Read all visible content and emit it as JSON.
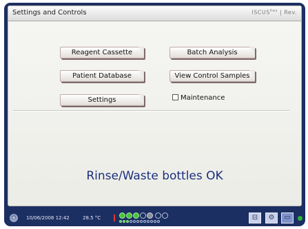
{
  "window": {
    "title": "Settings and Controls",
    "brand": "ISCUS",
    "brand_sup": "flex",
    "brand_suffix": " | Rev."
  },
  "buttons": {
    "reagent_cassette": "Reagent Cassette",
    "batch_analysis": "Batch Analysis",
    "patient_database": "Patient Database",
    "view_control_samples": "View Control Samples",
    "settings": "Settings"
  },
  "maintenance": {
    "label": "Maintenance",
    "checked": false
  },
  "status_message": "Rinse/Waste bottles OK",
  "statusbar": {
    "datetime": "10/06/2008 12:42",
    "temperature": "28.5 °C",
    "sample_slots": [
      "green",
      "green",
      "green",
      "empty",
      "gray",
      "empty",
      "empty"
    ],
    "icons": [
      "tray-icon",
      "gear-icon",
      "folder-icon"
    ]
  },
  "colors": {
    "frame": "#1c2f62",
    "status_text": "#1a2f7c",
    "indicator_green": "#49c23d"
  }
}
